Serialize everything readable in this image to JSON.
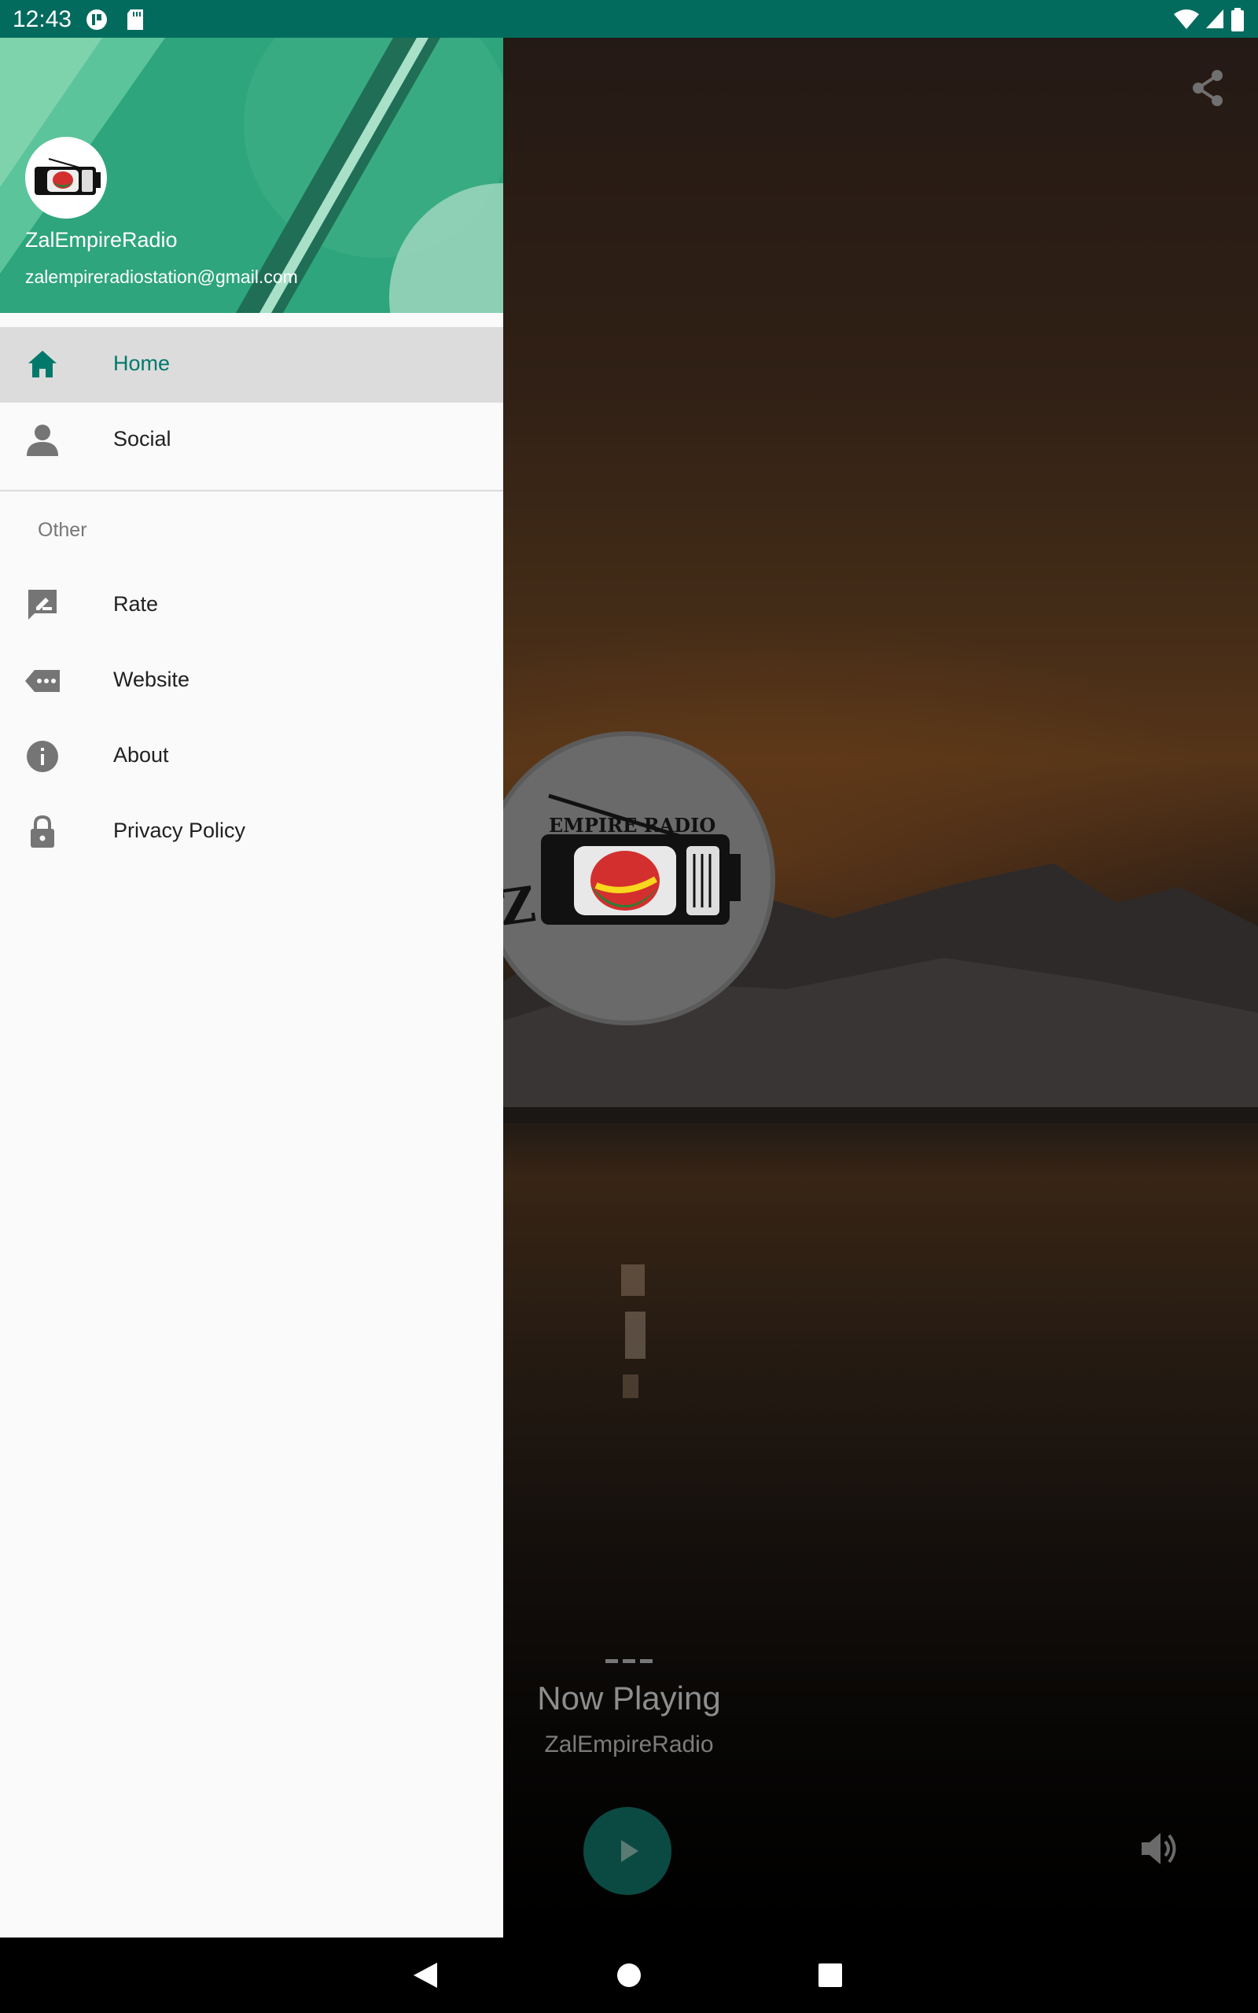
{
  "status_bar": {
    "time": "12:43",
    "left_icons": [
      "notification-app-icon",
      "sd-card-icon"
    ],
    "right_icons": [
      "wifi-icon",
      "cell-signal-icon",
      "battery-icon"
    ]
  },
  "drawer": {
    "header": {
      "app_name": "ZalEmpireRadio",
      "email": "zalempireradiostation@gmail.com"
    },
    "items": [
      {
        "label": "Home",
        "icon": "home-icon",
        "active": true
      },
      {
        "label": "Social",
        "icon": "person-icon",
        "active": false
      }
    ],
    "section_title": "Other",
    "other_items": [
      {
        "label": "Rate",
        "icon": "rate-review-icon"
      },
      {
        "label": "Website",
        "icon": "website-tag-icon"
      },
      {
        "label": "About",
        "icon": "info-icon"
      },
      {
        "label": "Privacy Policy",
        "icon": "lock-icon"
      }
    ]
  },
  "player": {
    "dash": "---",
    "now_playing_title": "Now Playing",
    "station_name": "ZalEmpireRadio",
    "logo_text": "EMPIRE RADIO"
  },
  "colors": {
    "status_bar": "#026b5e",
    "drawer_header": "#2ea57c",
    "accent": "#00796b"
  }
}
